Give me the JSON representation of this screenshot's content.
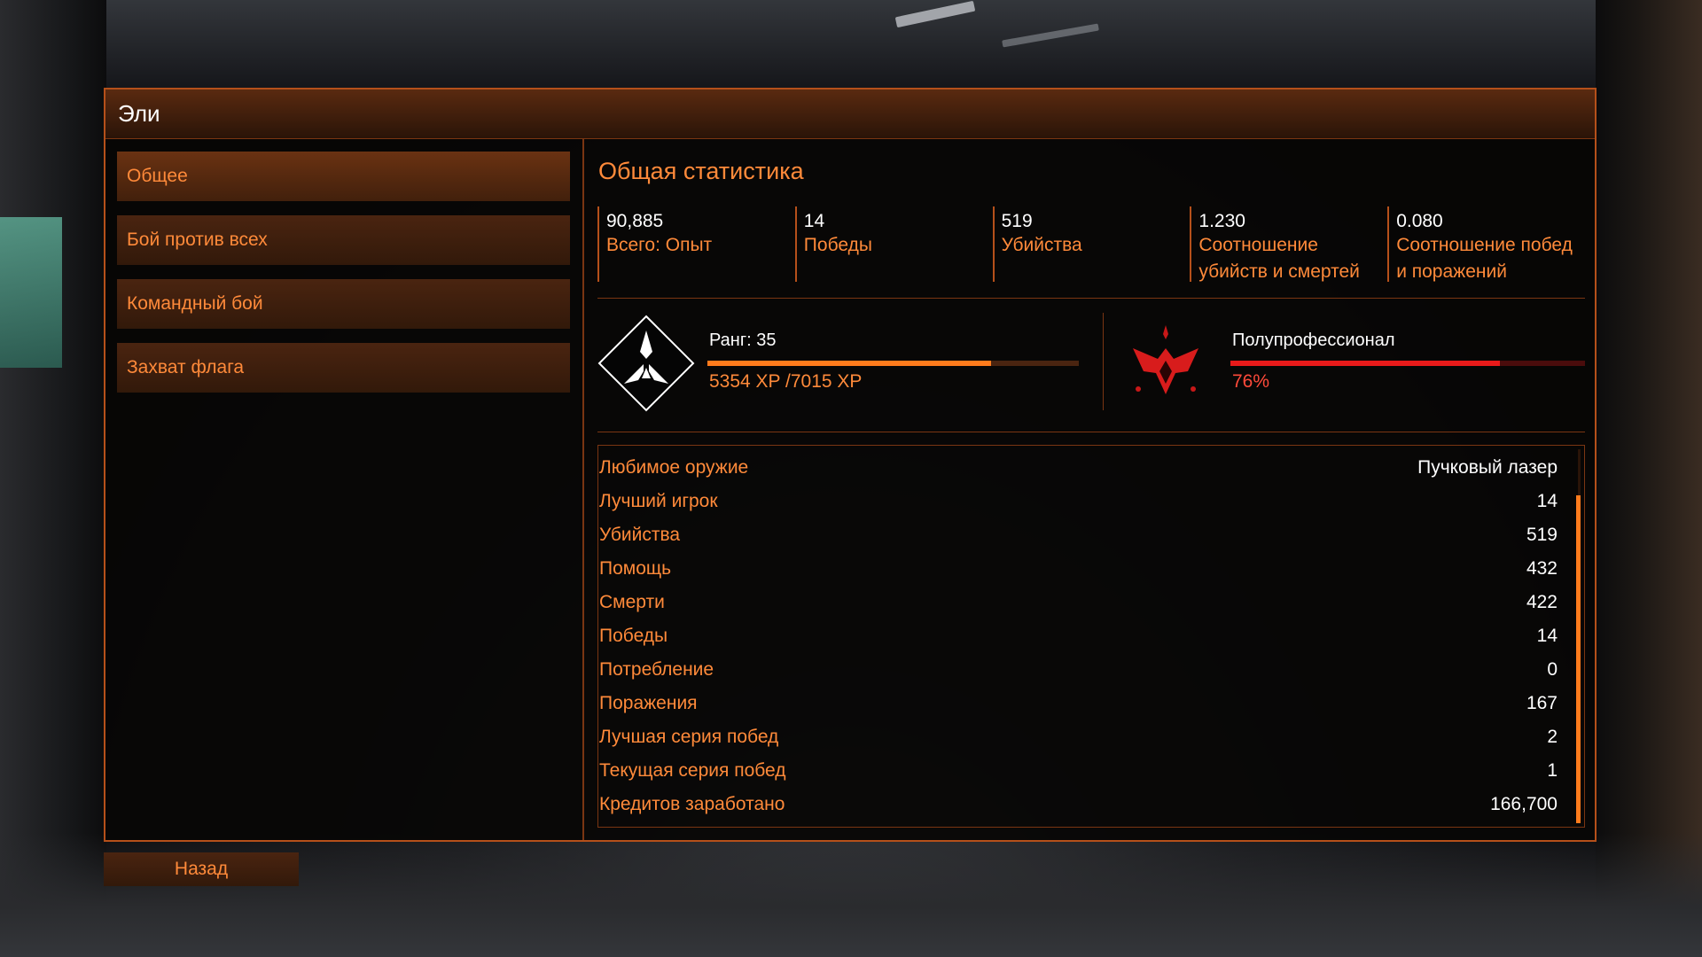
{
  "window": {
    "title": "Эли"
  },
  "sidebar": {
    "tabs": [
      {
        "label": "Общее"
      },
      {
        "label": "Бой против всех"
      },
      {
        "label": "Командный бой"
      },
      {
        "label": "Захват флага"
      }
    ]
  },
  "main": {
    "title": "Общая статистика",
    "summary": [
      {
        "value": "90,885",
        "label": "Всего: Опыт"
      },
      {
        "value": "14",
        "label": "Победы"
      },
      {
        "value": "519",
        "label": "Убийства"
      },
      {
        "value": "1.230",
        "label": "Соотношение убийств и смертей"
      },
      {
        "value": "0.080",
        "label": "Соотношение побед и поражений"
      }
    ],
    "rank": {
      "label": "Ранг: 35",
      "xp": "5354 XP /7015 XP",
      "progress": 0.763
    },
    "skill": {
      "label": "Полупрофессионал",
      "percent": "76%",
      "progress": 0.76
    },
    "stats": [
      {
        "label": "Любимое оружие",
        "value": "Пучковый лазер"
      },
      {
        "label": "Лучший игрок",
        "value": "14"
      },
      {
        "label": "Убийства",
        "value": "519"
      },
      {
        "label": "Помощь",
        "value": "432"
      },
      {
        "label": "Смерти",
        "value": "422"
      },
      {
        "label": "Победы",
        "value": "14"
      },
      {
        "label": "Потребление",
        "value": "0"
      },
      {
        "label": "Поражения",
        "value": "167"
      },
      {
        "label": "Лучшая серия побед",
        "value": "2"
      },
      {
        "label": "Текущая серия побед",
        "value": "1"
      },
      {
        "label": "Кредитов заработано",
        "value": "166,700"
      }
    ]
  },
  "footer": {
    "back_label": "Назад"
  },
  "colors": {
    "accent": "#ff7b1c",
    "text_orange": "#ff8a3a",
    "skill_red": "#e81a1a",
    "border": "#b5501a"
  },
  "icons": {
    "rank": "rank-diamond-icon",
    "skill": "skill-emblem-icon"
  }
}
